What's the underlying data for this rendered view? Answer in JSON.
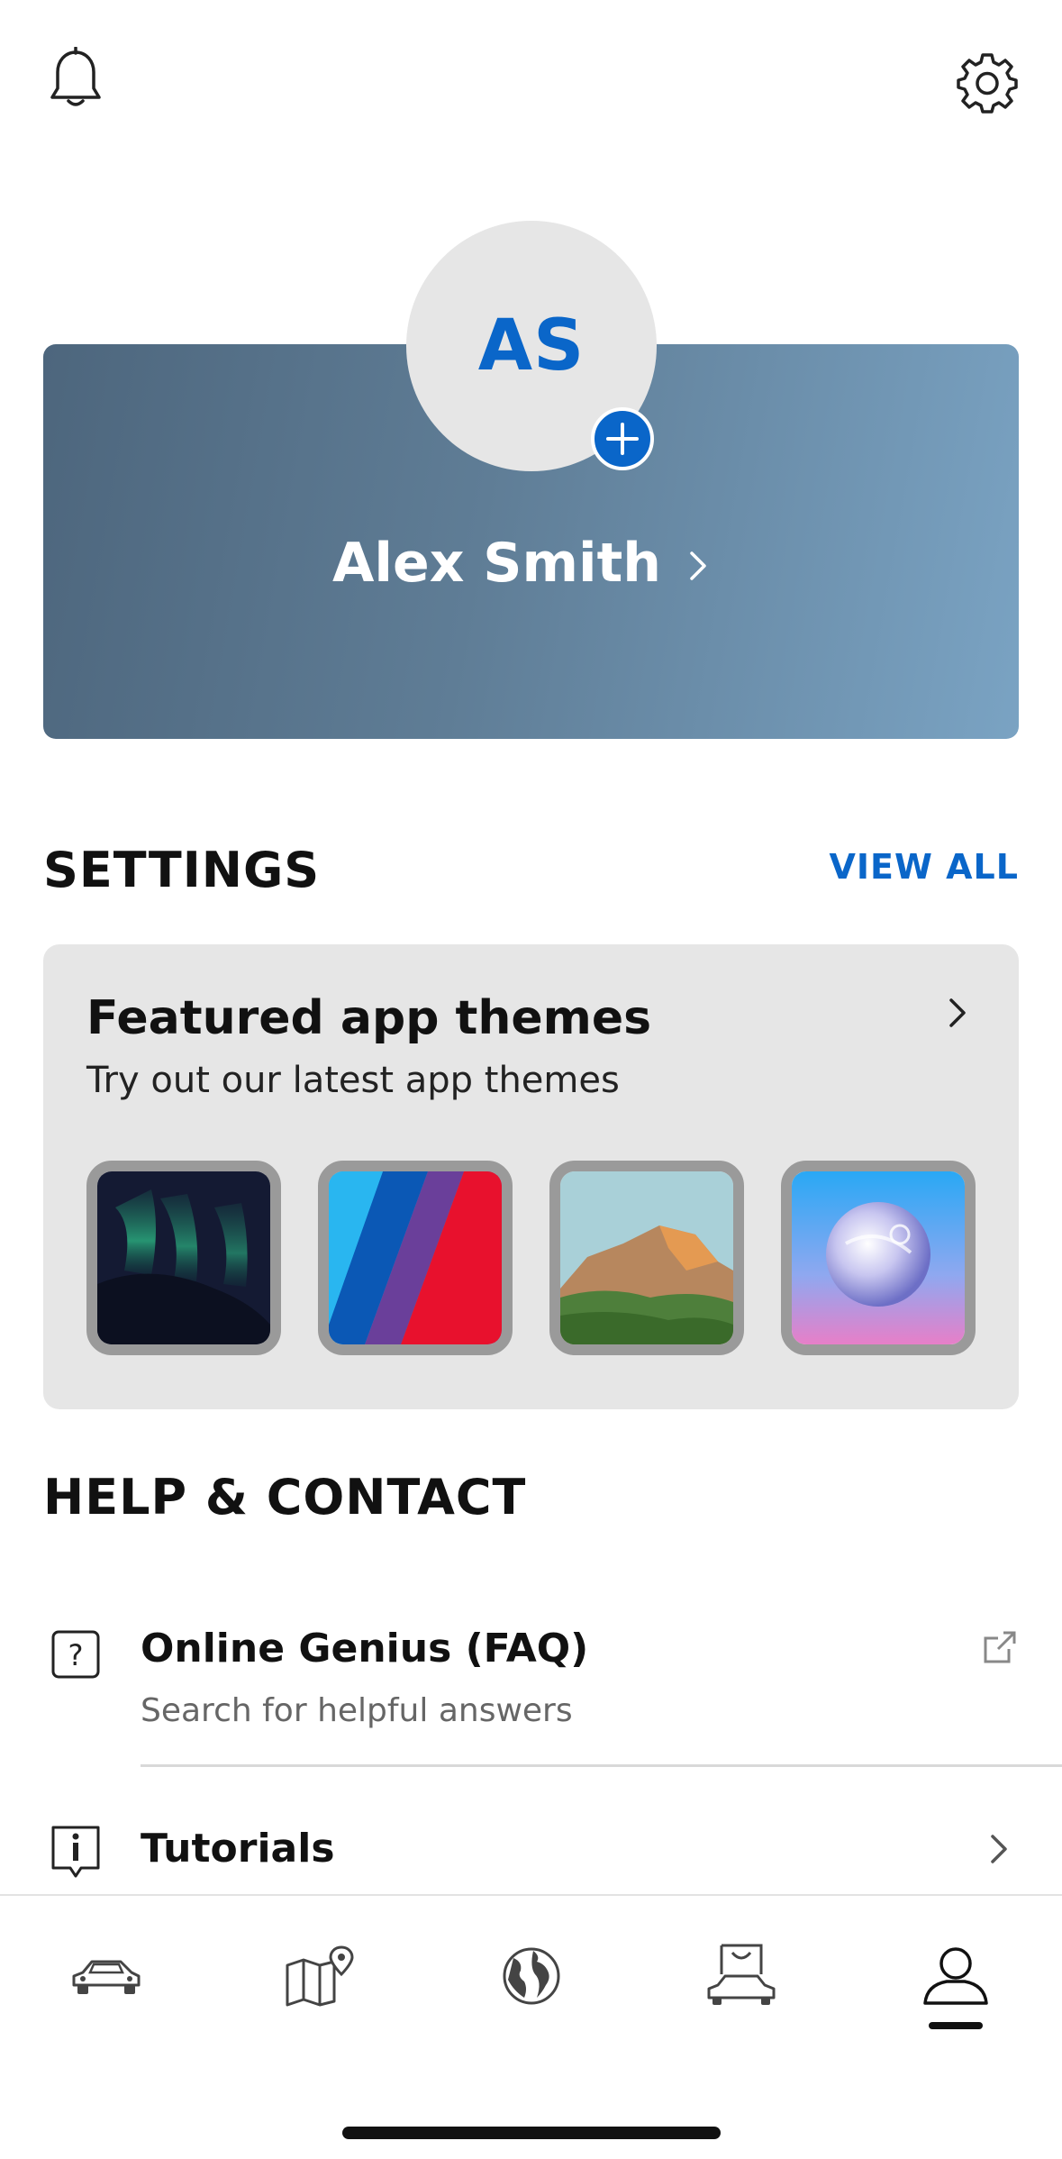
{
  "header": {
    "notifications_icon": "bell-icon",
    "settings_icon": "gear-icon"
  },
  "profile": {
    "initials": "AS",
    "name": "Alex Smith",
    "add_icon": "plus-icon",
    "colors": {
      "accent": "#0a66c9",
      "card_gradient_start": "#4d667d",
      "card_gradient_end": "#7aa3c3"
    }
  },
  "settings": {
    "title": "SETTINGS",
    "view_all": "VIEW ALL",
    "themes": {
      "title": "Featured app themes",
      "subtitle": "Try out our latest app themes",
      "thumbnails": [
        "aurora-theme",
        "m-stripes-theme",
        "mountain-theme",
        "sphere-theme"
      ]
    }
  },
  "help": {
    "title": "HELP & CONTACT",
    "items": [
      {
        "title": "Online Genius (FAQ)",
        "subtitle": "Search for helpful answers",
        "icon": "question-icon",
        "action_icon": "external-link-icon"
      },
      {
        "title": "Tutorials",
        "icon": "info-icon",
        "action_icon": "chevron-right-icon"
      }
    ]
  },
  "tab_bar": {
    "tabs": [
      "car-icon",
      "map-pin-icon",
      "globe-icon",
      "shop-car-icon",
      "profile-icon"
    ],
    "active": "profile-icon"
  }
}
